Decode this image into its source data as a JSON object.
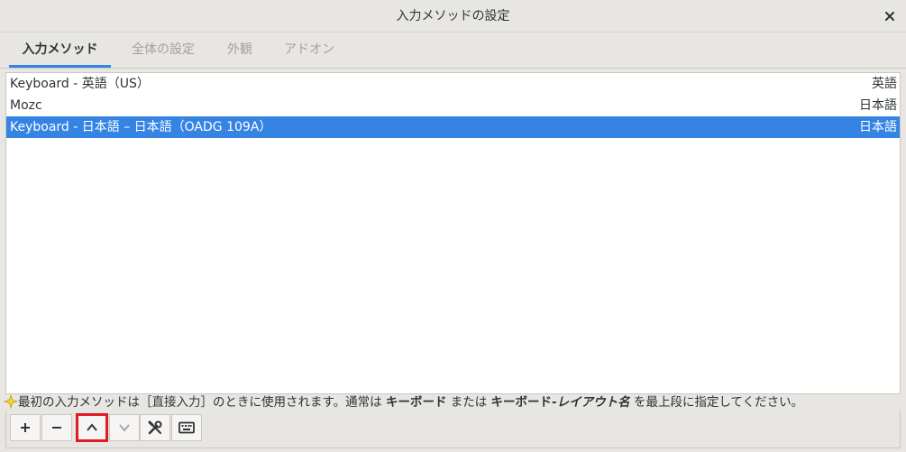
{
  "window": {
    "title": "入力メソッドの設定",
    "close_icon": "close-icon"
  },
  "tabs": [
    {
      "label": "入力メソッド",
      "active": true
    },
    {
      "label": "全体の設定",
      "active": false
    },
    {
      "label": "外観",
      "active": false
    },
    {
      "label": "アドオン",
      "active": false
    }
  ],
  "input_methods": [
    {
      "name": "Keyboard - 英語（US）",
      "language": "英語",
      "selected": false
    },
    {
      "name": "Mozc",
      "language": "日本語",
      "selected": false
    },
    {
      "name": "Keyboard - 日本語 – 日本語（OADG 109A）",
      "language": "日本語",
      "selected": true
    }
  ],
  "hint": {
    "icon": "star-icon",
    "text_before": "最初の入力メソッドは［直接入力］のときに使用されます。通常は ",
    "bold1": "キーボード",
    "text_middle": " または ",
    "bold2": "キーボード-",
    "italic": "レイアウト名",
    "text_after": " を最上段に指定してください。"
  },
  "toolbar": {
    "buttons": [
      {
        "icon": "plus-icon",
        "enabled": true
      },
      {
        "icon": "minus-icon",
        "enabled": true
      },
      {
        "icon": "chevron-up-icon",
        "enabled": true,
        "highlighted": true
      },
      {
        "icon": "chevron-down-icon",
        "enabled": false
      },
      {
        "icon": "configure-icon",
        "enabled": true
      },
      {
        "icon": "keyboard-icon",
        "enabled": true
      }
    ]
  },
  "colors": {
    "accent": "#3584e4",
    "highlight_border": "#e01b24"
  }
}
